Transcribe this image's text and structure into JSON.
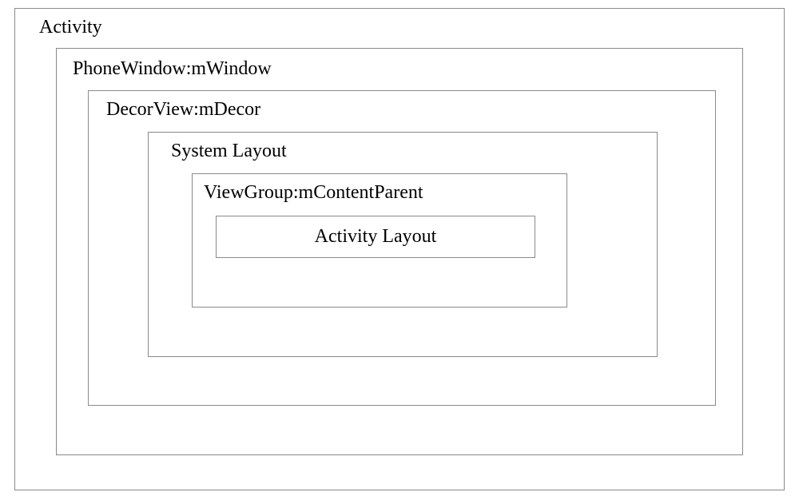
{
  "diagram": {
    "activity": "Activity",
    "phoneWindow": "PhoneWindow:mWindow",
    "decorView": "DecorView:mDecor",
    "systemLayout": "System Layout",
    "viewGroup": "ViewGroup:mContentParent",
    "activityLayout": "Activity Layout"
  }
}
